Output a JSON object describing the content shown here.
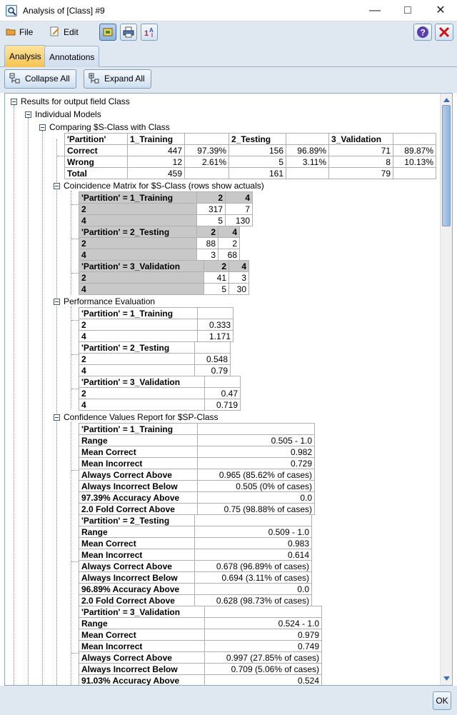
{
  "window": {
    "title": "Analysis of [Class] #9"
  },
  "menu": {
    "file": "File",
    "edit": "Edit"
  },
  "tabs": [
    {
      "label": "Analysis"
    },
    {
      "label": "Annotations"
    }
  ],
  "actions": {
    "collapse": "Collapse All",
    "expand": "Expand All"
  },
  "ok_label": "OK",
  "tree": {
    "root": "Results for output field Class",
    "individual": "Individual Models",
    "comparing": "Comparing $S-Class with Class",
    "coincidence": "Coincidence Matrix for $S-Class (rows show actuals)",
    "performance": "Performance Evaluation",
    "confidence": "Confidence Values Report for $SP-Class"
  },
  "comparison": {
    "header": [
      "'Partition'",
      "1_Training",
      "",
      "2_Testing",
      "",
      "3_Validation",
      ""
    ],
    "rows": [
      [
        "Correct",
        "447",
        "97.39%",
        "156",
        "96.89%",
        "71",
        "89.87%"
      ],
      [
        "Wrong",
        "12",
        "2.61%",
        "5",
        "3.11%",
        "8",
        "10.13%"
      ],
      [
        "Total",
        "459",
        "",
        "161",
        "",
        "79",
        ""
      ]
    ]
  },
  "coincidence": [
    {
      "header": [
        "'Partition' = 1_Training",
        "2",
        "4"
      ],
      "rows": [
        [
          "2",
          "317",
          "7"
        ],
        [
          "4",
          "5",
          "130"
        ]
      ]
    },
    {
      "header": [
        "'Partition' = 2_Testing",
        "2",
        "4"
      ],
      "rows": [
        [
          "2",
          "88",
          "2"
        ],
        [
          "4",
          "3",
          "68"
        ]
      ]
    },
    {
      "header": [
        "'Partition' = 3_Validation",
        "2",
        "4"
      ],
      "rows": [
        [
          "2",
          "41",
          "3"
        ],
        [
          "4",
          "5",
          "30"
        ]
      ]
    }
  ],
  "performance": [
    {
      "header": [
        "'Partition' = 1_Training",
        ""
      ],
      "rows": [
        [
          "2",
          "0.333"
        ],
        [
          "4",
          "1.171"
        ]
      ]
    },
    {
      "header": [
        "'Partition' = 2_Testing",
        ""
      ],
      "rows": [
        [
          "2",
          "0.548"
        ],
        [
          "4",
          "0.79"
        ]
      ]
    },
    {
      "header": [
        "'Partition' = 3_Validation",
        ""
      ],
      "rows": [
        [
          "2",
          "0.47"
        ],
        [
          "4",
          "0.719"
        ]
      ]
    }
  ],
  "confidence": [
    {
      "header": [
        "'Partition' = 1_Training",
        ""
      ],
      "rows": [
        [
          "Range",
          "0.505 - 1.0"
        ],
        [
          "Mean Correct",
          "0.982"
        ],
        [
          "Mean Incorrect",
          "0.729"
        ],
        [
          "Always Correct Above",
          "0.965 (85.62% of cases)"
        ],
        [
          "Always Incorrect Below",
          "0.505 (0% of cases)"
        ],
        [
          "97.39% Accuracy Above",
          "0.0"
        ],
        [
          "2.0 Fold Correct Above",
          "0.75 (98.88% of cases)"
        ]
      ]
    },
    {
      "header": [
        "'Partition' = 2_Testing",
        ""
      ],
      "rows": [
        [
          "Range",
          "0.509 - 1.0"
        ],
        [
          "Mean Correct",
          "0.983"
        ],
        [
          "Mean Incorrect",
          "0.614"
        ],
        [
          "Always Correct Above",
          "0.678 (96.89% of cases)"
        ],
        [
          "Always Incorrect Below",
          "0.694 (3.11% of cases)"
        ],
        [
          "96.89% Accuracy Above",
          "0.0"
        ],
        [
          "2.0 Fold Correct Above",
          "0.628 (98.73% of cases)"
        ]
      ]
    },
    {
      "header": [
        "'Partition' = 3_Validation",
        ""
      ],
      "rows": [
        [
          "Range",
          "0.524 - 1.0"
        ],
        [
          "Mean Correct",
          "0.979"
        ],
        [
          "Mean Incorrect",
          "0.749"
        ],
        [
          "Always Correct Above",
          "0.997 (27.85% of cases)"
        ],
        [
          "Always Incorrect Below",
          "0.709 (5.06% of cases)"
        ],
        [
          "91.03% Accuracy Above",
          "0.524"
        ]
      ]
    }
  ]
}
